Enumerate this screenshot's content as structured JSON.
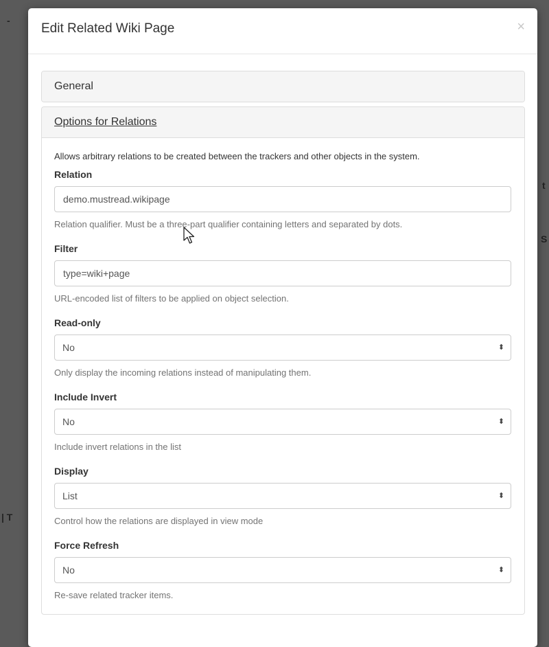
{
  "modal": {
    "title": "Edit Related Wiki Page",
    "close_symbol": "×"
  },
  "panels": {
    "general_label": "General",
    "options_label": "Options for Relations"
  },
  "intro": "Allows arbitrary relations to be created between the trackers and other objects in the system.",
  "fields": {
    "relation": {
      "label": "Relation",
      "value": "demo.mustread.wikipage",
      "help": "Relation qualifier. Must be a three-part qualifier containing letters and separated by dots."
    },
    "filter": {
      "label": "Filter",
      "value": "type=wiki+page",
      "help": "URL-encoded list of filters to be applied on object selection."
    },
    "read_only": {
      "label": "Read-only",
      "value": "No",
      "help": "Only display the incoming relations instead of manipulating them."
    },
    "include_invert": {
      "label": "Include Invert",
      "value": "No",
      "help": "Include invert relations in the list"
    },
    "display": {
      "label": "Display",
      "value": "List",
      "help": "Control how the relations are displayed in view mode"
    },
    "force_refresh": {
      "label": "Force Refresh",
      "value": "No",
      "help": "Re-save related tracker items."
    }
  },
  "select_arrow_symbol": "⬍",
  "icons": [
    "close-icon",
    "select-arrow-icon",
    "mouse-cursor-icon"
  ]
}
